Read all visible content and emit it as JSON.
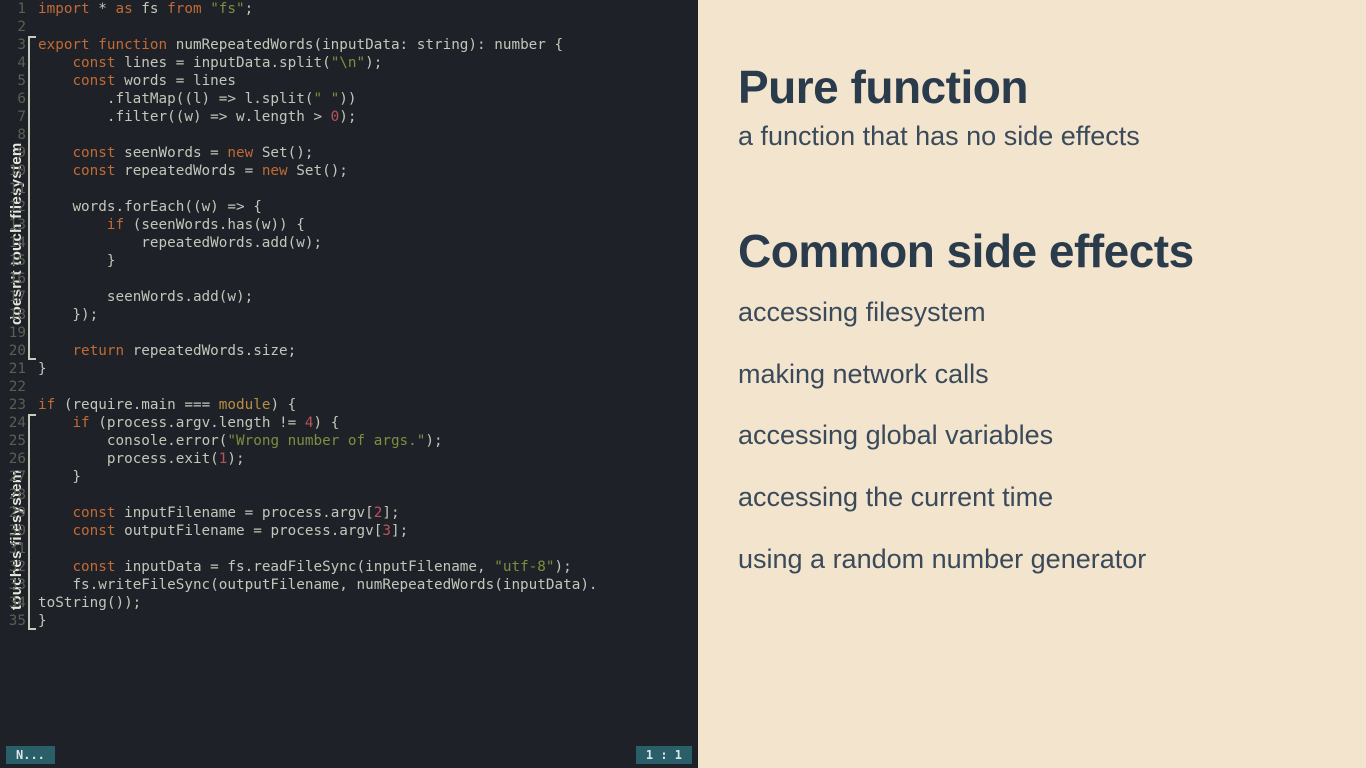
{
  "editor": {
    "annotations": {
      "top": {
        "label": "doesn't touch filesystem"
      },
      "bottom": {
        "label": "touches filesystem"
      }
    },
    "lines": [
      {
        "n": 1,
        "tokens": [
          [
            "kw",
            "import"
          ],
          [
            "pnc",
            " * "
          ],
          [
            "kw",
            "as"
          ],
          [
            "pnc",
            " fs "
          ],
          [
            "kw",
            "from"
          ],
          [
            "pnc",
            " "
          ],
          [
            "str",
            "\"fs\""
          ],
          [
            "pnc",
            ";"
          ]
        ]
      },
      {
        "n": 2,
        "tokens": []
      },
      {
        "n": 3,
        "tokens": [
          [
            "kw",
            "export function"
          ],
          [
            "pnc",
            " "
          ],
          [
            "fn",
            "numRepeatedWords"
          ],
          [
            "pnc",
            "("
          ],
          [
            "id",
            "inputData"
          ],
          [
            "pnc",
            ": "
          ],
          [
            "type",
            "string"
          ],
          [
            "pnc",
            "): "
          ],
          [
            "type",
            "number"
          ],
          [
            "pnc",
            " {"
          ]
        ]
      },
      {
        "n": 4,
        "tokens": [
          [
            "pnc",
            "    "
          ],
          [
            "kw",
            "const"
          ],
          [
            "pnc",
            " "
          ],
          [
            "id",
            "lines"
          ],
          [
            "pnc",
            " = "
          ],
          [
            "id",
            "inputData"
          ],
          [
            "pnc",
            ".split("
          ],
          [
            "str",
            "\"\\n\""
          ],
          [
            "pnc",
            ");"
          ]
        ]
      },
      {
        "n": 5,
        "tokens": [
          [
            "pnc",
            "    "
          ],
          [
            "kw",
            "const"
          ],
          [
            "pnc",
            " "
          ],
          [
            "id",
            "words"
          ],
          [
            "pnc",
            " = "
          ],
          [
            "id",
            "lines"
          ]
        ]
      },
      {
        "n": 6,
        "tokens": [
          [
            "pnc",
            "        .flatMap(("
          ],
          [
            "id",
            "l"
          ],
          [
            "pnc",
            ") => "
          ],
          [
            "id",
            "l"
          ],
          [
            "pnc",
            ".split("
          ],
          [
            "str",
            "\" \""
          ],
          [
            "pnc",
            "))"
          ]
        ]
      },
      {
        "n": 7,
        "tokens": [
          [
            "pnc",
            "        .filter(("
          ],
          [
            "id",
            "w"
          ],
          [
            "pnc",
            ") => "
          ],
          [
            "id",
            "w"
          ],
          [
            "pnc",
            ".length > "
          ],
          [
            "num",
            "0"
          ],
          [
            "pnc",
            ");"
          ]
        ]
      },
      {
        "n": 8,
        "tokens": []
      },
      {
        "n": 9,
        "tokens": [
          [
            "pnc",
            "    "
          ],
          [
            "kw",
            "const"
          ],
          [
            "pnc",
            " "
          ],
          [
            "id",
            "seenWords"
          ],
          [
            "pnc",
            " = "
          ],
          [
            "kw",
            "new"
          ],
          [
            "pnc",
            " "
          ],
          [
            "id",
            "Set"
          ],
          [
            "pnc",
            "();"
          ]
        ]
      },
      {
        "n": 10,
        "tokens": [
          [
            "pnc",
            "    "
          ],
          [
            "kw",
            "const"
          ],
          [
            "pnc",
            " "
          ],
          [
            "id",
            "repeatedWords"
          ],
          [
            "pnc",
            " = "
          ],
          [
            "kw",
            "new"
          ],
          [
            "pnc",
            " "
          ],
          [
            "id",
            "Set"
          ],
          [
            "pnc",
            "();"
          ]
        ]
      },
      {
        "n": 11,
        "tokens": []
      },
      {
        "n": 12,
        "tokens": [
          [
            "pnc",
            "    "
          ],
          [
            "id",
            "words"
          ],
          [
            "pnc",
            ".forEach(("
          ],
          [
            "id",
            "w"
          ],
          [
            "pnc",
            ") => {"
          ]
        ]
      },
      {
        "n": 13,
        "tokens": [
          [
            "pnc",
            "        "
          ],
          [
            "kw",
            "if"
          ],
          [
            "pnc",
            " ("
          ],
          [
            "id",
            "seenWords"
          ],
          [
            "pnc",
            ".has("
          ],
          [
            "id",
            "w"
          ],
          [
            "pnc",
            ")) {"
          ]
        ]
      },
      {
        "n": 14,
        "tokens": [
          [
            "pnc",
            "            "
          ],
          [
            "id",
            "repeatedWords"
          ],
          [
            "pnc",
            ".add("
          ],
          [
            "id",
            "w"
          ],
          [
            "pnc",
            ");"
          ]
        ]
      },
      {
        "n": 15,
        "tokens": [
          [
            "pnc",
            "        }"
          ]
        ]
      },
      {
        "n": 16,
        "tokens": []
      },
      {
        "n": 17,
        "tokens": [
          [
            "pnc",
            "        "
          ],
          [
            "id",
            "seenWords"
          ],
          [
            "pnc",
            ".add("
          ],
          [
            "id",
            "w"
          ],
          [
            "pnc",
            ");"
          ]
        ]
      },
      {
        "n": 18,
        "tokens": [
          [
            "pnc",
            "    });"
          ]
        ]
      },
      {
        "n": 19,
        "tokens": []
      },
      {
        "n": 20,
        "tokens": [
          [
            "pnc",
            "    "
          ],
          [
            "kw",
            "return"
          ],
          [
            "pnc",
            " "
          ],
          [
            "id",
            "repeatedWords"
          ],
          [
            "pnc",
            ".size;"
          ]
        ]
      },
      {
        "n": 21,
        "tokens": [
          [
            "pnc",
            "}"
          ]
        ]
      },
      {
        "n": 22,
        "tokens": []
      },
      {
        "n": 23,
        "tokens": [
          [
            "kw",
            "if"
          ],
          [
            "pnc",
            " ("
          ],
          [
            "global",
            "require"
          ],
          [
            "pnc",
            ".main === "
          ],
          [
            "kw2",
            "module"
          ],
          [
            "pnc",
            ") {"
          ]
        ]
      },
      {
        "n": 24,
        "tokens": [
          [
            "pnc",
            "    "
          ],
          [
            "kw",
            "if"
          ],
          [
            "pnc",
            " ("
          ],
          [
            "global",
            "process"
          ],
          [
            "pnc",
            ".argv.length != "
          ],
          [
            "num",
            "4"
          ],
          [
            "pnc",
            ") {"
          ]
        ]
      },
      {
        "n": 25,
        "tokens": [
          [
            "pnc",
            "        "
          ],
          [
            "global",
            "console"
          ],
          [
            "pnc",
            ".error("
          ],
          [
            "str",
            "\"Wrong number of args.\""
          ],
          [
            "pnc",
            ");"
          ]
        ]
      },
      {
        "n": 26,
        "tokens": [
          [
            "pnc",
            "        "
          ],
          [
            "global",
            "process"
          ],
          [
            "pnc",
            ".exit("
          ],
          [
            "num",
            "1"
          ],
          [
            "pnc",
            ");"
          ]
        ]
      },
      {
        "n": 27,
        "tokens": [
          [
            "pnc",
            "    }"
          ]
        ]
      },
      {
        "n": 28,
        "tokens": []
      },
      {
        "n": 29,
        "tokens": [
          [
            "pnc",
            "    "
          ],
          [
            "kw",
            "const"
          ],
          [
            "pnc",
            " "
          ],
          [
            "id",
            "inputFilename"
          ],
          [
            "pnc",
            " = "
          ],
          [
            "global",
            "process"
          ],
          [
            "pnc",
            ".argv["
          ],
          [
            "num",
            "2"
          ],
          [
            "pnc",
            "];"
          ]
        ]
      },
      {
        "n": 30,
        "tokens": [
          [
            "pnc",
            "    "
          ],
          [
            "kw",
            "const"
          ],
          [
            "pnc",
            " "
          ],
          [
            "id",
            "outputFilename"
          ],
          [
            "pnc",
            " = "
          ],
          [
            "global",
            "process"
          ],
          [
            "pnc",
            ".argv["
          ],
          [
            "num",
            "3"
          ],
          [
            "pnc",
            "];"
          ]
        ]
      },
      {
        "n": 31,
        "tokens": []
      },
      {
        "n": 32,
        "tokens": [
          [
            "pnc",
            "    "
          ],
          [
            "kw",
            "const"
          ],
          [
            "pnc",
            " "
          ],
          [
            "id",
            "inputData"
          ],
          [
            "pnc",
            " = "
          ],
          [
            "id",
            "fs"
          ],
          [
            "pnc",
            ".readFileSync("
          ],
          [
            "id",
            "inputFilename"
          ],
          [
            "pnc",
            ", "
          ],
          [
            "str",
            "\"utf-8\""
          ],
          [
            "pnc",
            ");"
          ]
        ]
      },
      {
        "n": 33,
        "tokens": [
          [
            "pnc",
            "    "
          ],
          [
            "id",
            "fs"
          ],
          [
            "pnc",
            ".writeFileSync("
          ],
          [
            "id",
            "outputFilename"
          ],
          [
            "pnc",
            ", numRepeatedWords("
          ],
          [
            "id",
            "inputData"
          ],
          [
            "pnc",
            ")."
          ]
        ]
      },
      {
        "n": 34,
        "tokens": [
          [
            "pnc",
            "toString());"
          ]
        ]
      },
      {
        "n": 35,
        "tokens": [
          [
            "pnc",
            "}"
          ]
        ]
      }
    ],
    "status": {
      "mode": "N...",
      "pos": "1 : 1"
    }
  },
  "slide": {
    "h1a": "Pure function",
    "sub": "a function that has no side effects",
    "h1b": "Common side effects",
    "items": [
      "accessing filesystem",
      "making network calls",
      "accessing global variables",
      "accessing the current time",
      "using a random number generator"
    ]
  }
}
